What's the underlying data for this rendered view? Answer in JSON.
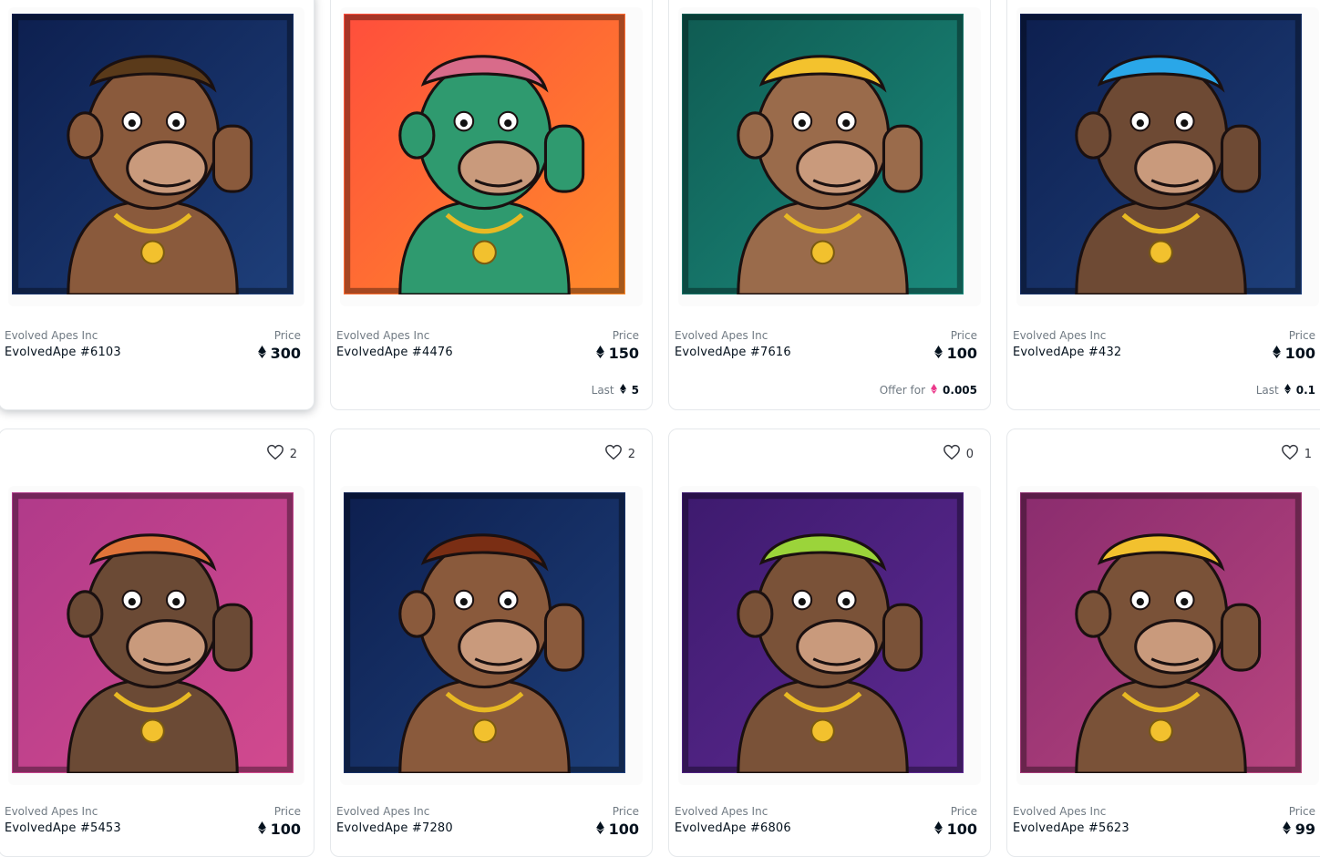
{
  "price_label": "Price",
  "cards": [
    {
      "collection": "Evolved Apes Inc",
      "name": "EvolvedApe #6103",
      "price": "300",
      "favorites": "",
      "sub_label": "",
      "sub_value": "",
      "sub_currency": "",
      "bg": [
        "#0d1f4f",
        "#1e3f7a"
      ]
    },
    {
      "collection": "Evolved Apes Inc",
      "name": "EvolvedApe #4476",
      "price": "150",
      "favorites": "",
      "sub_label": "Last",
      "sub_value": "5",
      "sub_currency": "eth",
      "bg": [
        "#ff4e3c",
        "#ff8a2a"
      ]
    },
    {
      "collection": "Evolved Apes Inc",
      "name": "EvolvedApe #7616",
      "price": "100",
      "favorites": "",
      "sub_label": "Offer for",
      "sub_value": "0.005",
      "sub_currency": "weth",
      "bg": [
        "#0f5b52",
        "#1b8a7c"
      ]
    },
    {
      "collection": "Evolved Apes Inc",
      "name": "EvolvedApe #432",
      "price": "100",
      "favorites": "",
      "sub_label": "Last",
      "sub_value": "0.1",
      "sub_currency": "eth",
      "bg": [
        "#0d1f4f",
        "#1e3f7a"
      ]
    },
    {
      "collection": "Evolved Apes Inc",
      "name": "EvolvedApe #5453",
      "price": "100",
      "favorites": "2",
      "sub_label": "",
      "sub_value": "",
      "sub_currency": "",
      "bg": [
        "#b03a8a",
        "#d24a8e"
      ]
    },
    {
      "collection": "Evolved Apes Inc",
      "name": "EvolvedApe #7280",
      "price": "100",
      "favorites": "2",
      "sub_label": "",
      "sub_value": "",
      "sub_currency": "",
      "bg": [
        "#0d1f4f",
        "#1e3f7a"
      ]
    },
    {
      "collection": "Evolved Apes Inc",
      "name": "EvolvedApe #6806",
      "price": "100",
      "favorites": "0",
      "sub_label": "",
      "sub_value": "",
      "sub_currency": "",
      "bg": [
        "#3d1a6e",
        "#5e2a92"
      ]
    },
    {
      "collection": "Evolved Apes Inc",
      "name": "EvolvedApe #5623",
      "price": "99",
      "favorites": "1",
      "sub_label": "",
      "sub_value": "",
      "sub_currency": "",
      "bg": [
        "#8a2c6e",
        "#b8457f"
      ]
    }
  ],
  "colors": {
    "eth": "#04111d",
    "weth": "#eb3a8b",
    "border": "#e5e8eb",
    "muted": "#707a83"
  },
  "icons": {
    "favorite": "heart-icon",
    "currency": "ethereum-icon",
    "offer_currency": "weth-icon"
  }
}
